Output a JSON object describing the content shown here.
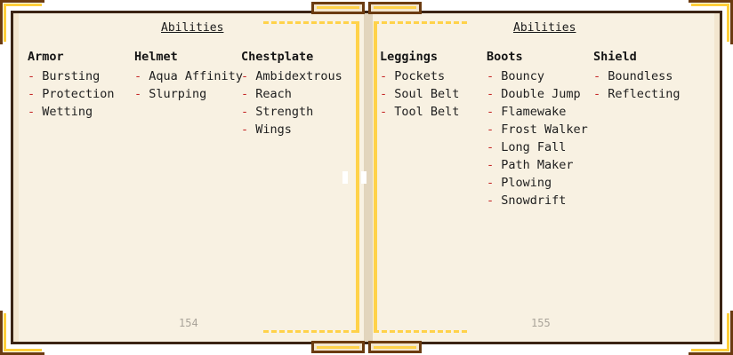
{
  "left_page": {
    "title": "Abilities",
    "page_number": "154",
    "columns": [
      {
        "heading": "Armor",
        "items": [
          "Bursting",
          "Protection",
          "Wetting"
        ]
      },
      {
        "heading": "Helmet",
        "items": [
          "Aqua Affinity",
          "Slurping"
        ]
      },
      {
        "heading": "Chestplate",
        "items": [
          "Ambidextrous",
          "Reach",
          "Strength",
          "Wings"
        ]
      }
    ]
  },
  "right_page": {
    "title": "Abilities",
    "page_number": "155",
    "columns": [
      {
        "heading": "Leggings",
        "items": [
          "Pockets",
          "Soul Belt",
          "Tool Belt"
        ]
      },
      {
        "heading": "Boots",
        "items": [
          "Bouncy",
          "Double Jump",
          "Flamewake",
          "Frost Walker",
          "Long Fall",
          "Path Maker",
          "Plowing",
          "Snowdrift"
        ]
      },
      {
        "heading": "Shield",
        "items": [
          "Boundless",
          "Reflecting"
        ]
      }
    ]
  },
  "bullet": "-",
  "colors": {
    "bullet": "#c62828",
    "page": "#f8f1e2",
    "border": "#3b2414",
    "gold": "#ffd24a",
    "corner": "#6b3b10"
  }
}
